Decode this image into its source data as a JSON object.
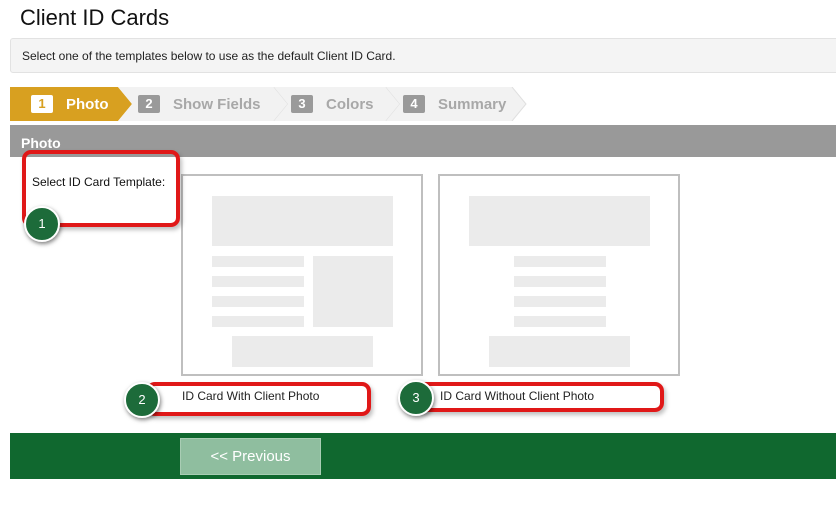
{
  "page": {
    "title": "Client ID Cards",
    "instructions": "Select one of the templates below to use as the default Client ID Card."
  },
  "wizard": {
    "steps": [
      {
        "number": "1",
        "label": "Photo",
        "active": true
      },
      {
        "number": "2",
        "label": "Show Fields",
        "active": false
      },
      {
        "number": "3",
        "label": "Colors",
        "active": false
      },
      {
        "number": "4",
        "label": "Summary",
        "active": false
      }
    ],
    "active_color": "#d8a020",
    "inactive_color": "#f2f2f2"
  },
  "photo_section": {
    "title": "Photo",
    "select_label": "Select ID Card Template:",
    "templates": [
      {
        "label": "ID Card With Client Photo",
        "layout": "with-photo"
      },
      {
        "label": "ID Card Without Client Photo",
        "layout": "without-photo"
      }
    ]
  },
  "annotations": [
    {
      "number": "1",
      "target": "select-id-card-template-label"
    },
    {
      "number": "2",
      "target": "id-card-with-client-photo"
    },
    {
      "number": "3",
      "target": "id-card-without-client-photo"
    }
  ],
  "footer": {
    "previous_label": "<< Previous"
  },
  "colors": {
    "footer_green": "#10682f",
    "annotation_red": "#e01818",
    "badge_green": "#1d6b3a",
    "section_header_gray": "#999999"
  }
}
